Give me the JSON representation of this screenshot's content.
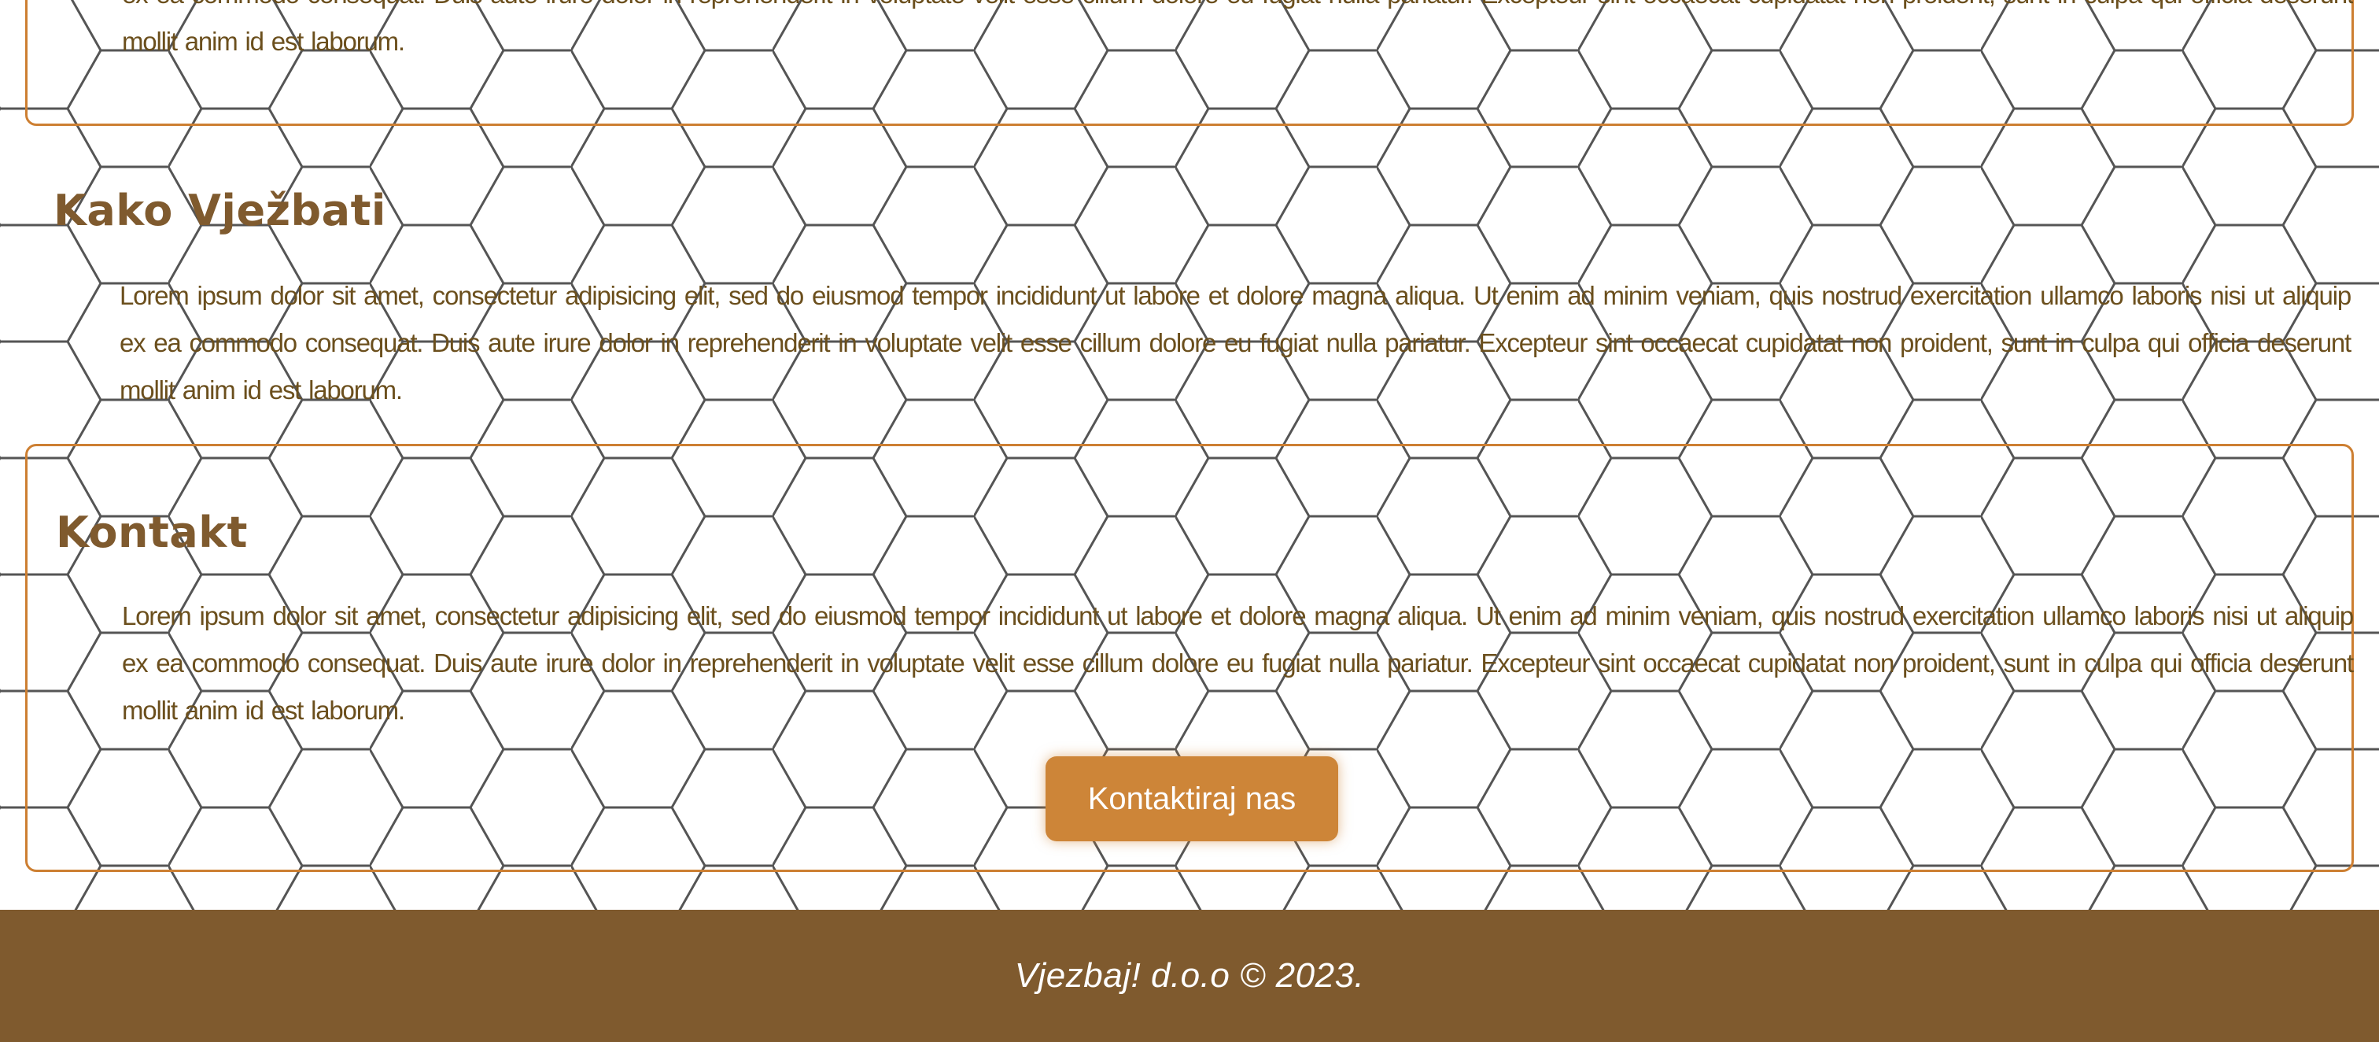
{
  "theme": {
    "primary": "#7f5a2e",
    "accent": "#cd7f32",
    "button": "#cd8538",
    "text": "#6b4f1d",
    "pattern_line": "#555555"
  },
  "background": {
    "pattern": "hexagon-grid"
  },
  "sections": [
    {
      "title": "",
      "text": "Lorem ipsum dolor sit amet, consectetur adipisicing elit, sed do eiusmod tempor incididunt ut labore et dolore magna aliqua. Ut enim ad minim veniam, quis nostrud exercitation ullamco laboris nisi ut aliquip ex ea commodo consequat. Duis aute irure dolor in reprehenderit in voluptate velit esse cillum dolore eu fugiat nulla pariatur. Excepteur sint occaecat cupidatat non proident, sunt in culpa qui officia deserunt mollit anim id est laborum."
    },
    {
      "title": "Kako Vježbati",
      "text": "Lorem ipsum dolor sit amet, consectetur adipisicing elit, sed do eiusmod tempor incididunt ut labore et dolore magna aliqua. Ut enim ad minim veniam, quis nostrud exercitation ullamco laboris nisi ut aliquip ex ea commodo consequat. Duis aute irure dolor in reprehenderit in voluptate velit esse cillum dolore eu fugiat nulla pariatur. Excepteur sint occaecat cupidatat non proident, sunt in culpa qui officia deserunt mollit anim id est laborum."
    },
    {
      "title": "Kontakt",
      "text": "Lorem ipsum dolor sit amet, consectetur adipisicing elit, sed do eiusmod tempor incididunt ut labore et dolore magna aliqua. Ut enim ad minim veniam, quis nostrud exercitation ullamco laboris nisi ut aliquip ex ea commodo consequat. Duis aute irure dolor in reprehenderit in voluptate velit esse cillum dolore eu fugiat nulla pariatur. Excepteur sint occaecat cupidatat non proident, sunt in culpa qui officia deserunt mollit anim id est laborum.",
      "button_label": "Kontaktiraj nas"
    }
  ],
  "footer": {
    "text": "Vjezbaj! d.o.o © 2023."
  }
}
